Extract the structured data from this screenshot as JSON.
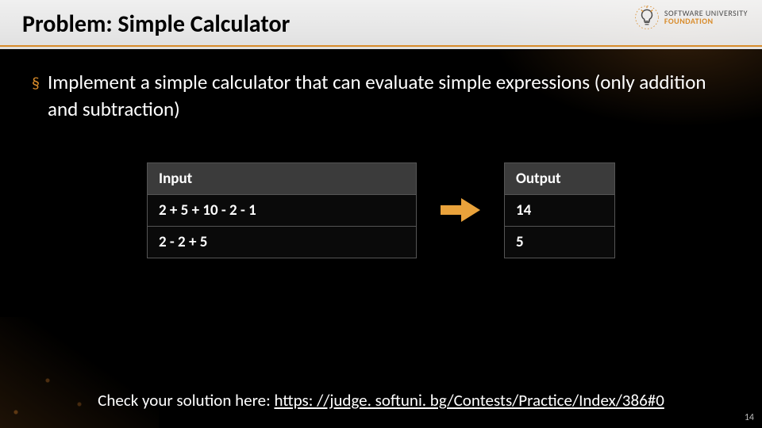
{
  "header": {
    "title": "Problem: Simple Calculator",
    "logo_line1": "SOFTWARE UNIVERSITY",
    "logo_line2": "FOUNDATION"
  },
  "bullet": {
    "text": "Implement a simple calculator that can evaluate simple expressions (only addition and subtraction)"
  },
  "table": {
    "input_header": "Input",
    "output_header": "Output",
    "rows": [
      {
        "input": "2 + 5 + 10 - 2 - 1",
        "output": "14"
      },
      {
        "input": "2 - 2 + 5",
        "output": "5"
      }
    ]
  },
  "footer": {
    "prefix": "Check your solution here: ",
    "link_text": "https: //judge. softuni. bg/Contests/Practice/Index/386#0"
  },
  "page_number": "14",
  "colors": {
    "accent": "#d88b2a"
  }
}
